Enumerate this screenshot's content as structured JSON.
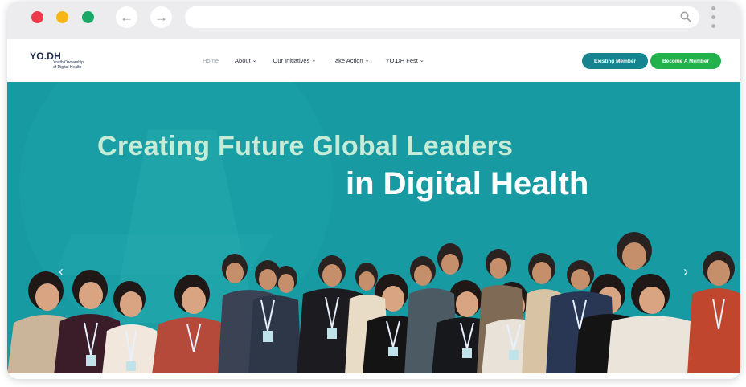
{
  "browser": {
    "back_icon": "arrow-left-icon",
    "forward_icon": "arrow-right-icon",
    "search_icon": "search-icon",
    "menu_icon": "kebab-menu-icon",
    "traffic_lights": [
      "#ee3b4c",
      "#f8b516",
      "#1aa866"
    ]
  },
  "site": {
    "logo": {
      "main": "YO.DH",
      "sub_line1": "Youth Ownership",
      "sub_line2": "of Digital Health"
    },
    "nav": {
      "home": "Home",
      "about": "About",
      "initiatives": "Our Initiatives",
      "take_action": "Take Action",
      "fest": "YO.DH Fest"
    },
    "buttons": {
      "existing": "Existing Member",
      "become": "Become A Member"
    }
  },
  "hero": {
    "line1": "Creating Future Global Leaders",
    "line2": "in Digital Health",
    "prev_icon": "chevron-left-icon",
    "next_icon": "chevron-right-icon",
    "image": "group-photo-of-attendees"
  },
  "colors": {
    "hero_bg": "#189aa3",
    "headline1": "#c6ecd8",
    "existing_btn": "#16848f",
    "become_btn": "#22b24c"
  }
}
